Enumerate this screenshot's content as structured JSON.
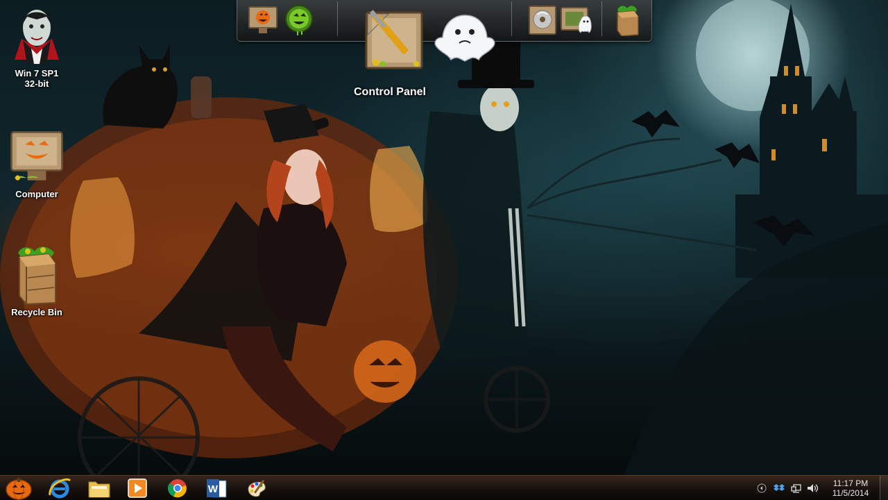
{
  "desktop": {
    "icons": [
      {
        "label": "Win 7 SP1\n32-bit",
        "line1": "Win 7 SP1",
        "line2": "32-bit",
        "icon": "vampire-icon"
      },
      {
        "label": "Computer",
        "icon": "computer-sign-icon"
      },
      {
        "label": "Recycle Bin",
        "icon": "recycle-bin-crate-icon"
      }
    ]
  },
  "dock": {
    "hover_label": "Control Panel",
    "items": [
      {
        "icon": "pumpkin-sign-icon"
      },
      {
        "icon": "green-orb-icon"
      },
      {
        "icon": "control-panel-icon"
      },
      {
        "icon": "ghost-icon"
      },
      {
        "icon": "disc-icon"
      },
      {
        "icon": "ghost-sign-icon"
      },
      {
        "icon": "crate-icon"
      }
    ]
  },
  "taskbar": {
    "start_icon": "pumpkin-start-icon",
    "pinned": [
      {
        "icon": "internet-explorer-icon"
      },
      {
        "icon": "file-explorer-icon"
      },
      {
        "icon": "media-player-icon"
      },
      {
        "icon": "chrome-icon"
      },
      {
        "icon": "word-icon"
      },
      {
        "icon": "paint-icon"
      }
    ],
    "tray": {
      "icons": [
        "show-hidden-icon",
        "dropbox-icon",
        "network-icon",
        "volume-icon"
      ]
    },
    "clock": {
      "time": "11:17 PM",
      "date": "11/5/2014"
    }
  },
  "colors": {
    "pumpkin": "#e06a1a",
    "night_teal": "#10262c",
    "moon": "#cfe6e6"
  }
}
